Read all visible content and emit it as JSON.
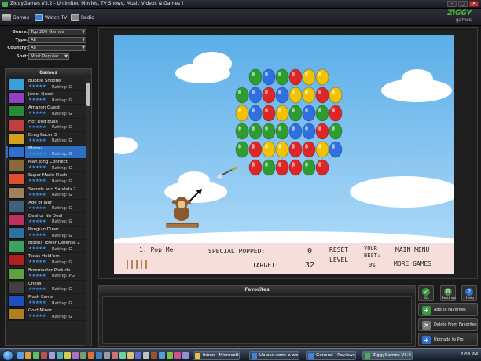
{
  "window": {
    "title": "ZiggyGames V3.2 - Unlimited Movies, TV Shows, Music Videos & Games !"
  },
  "nav": {
    "tabs": [
      {
        "label": "Games",
        "icon": "gamepad-icon"
      },
      {
        "label": "Watch TV",
        "icon": "tv-icon"
      },
      {
        "label": "Radio",
        "icon": "radio-icon"
      }
    ],
    "brand_line1": "ZIGGY",
    "brand_line2": "games"
  },
  "filters": [
    {
      "label": "Genre:",
      "value": "Top 200 Games"
    },
    {
      "label": "Type:",
      "value": "All"
    },
    {
      "label": "Country:",
      "value": "All"
    },
    {
      "label": "Sort:",
      "value": "Most Popular"
    }
  ],
  "games_panel": {
    "title": "Games",
    "rating_prefix": "Rating:",
    "items": [
      {
        "name": "Bubble Shooter",
        "stars": "★★★★★",
        "rating": "G"
      },
      {
        "name": "Jewel Quest",
        "stars": "★★★★★",
        "rating": "G"
      },
      {
        "name": "Amazon Quest",
        "stars": "★★★★★",
        "rating": "G"
      },
      {
        "name": "Hot Dog Bush",
        "stars": "★★★★★",
        "rating": "G"
      },
      {
        "name": "Drag Racer 3",
        "stars": "★★★★★",
        "rating": "G"
      },
      {
        "name": "Bloons",
        "stars": "★★★★★",
        "rating": "G",
        "selected": true
      },
      {
        "name": "Mah Jong Connect",
        "stars": "★★★★★",
        "rating": "G"
      },
      {
        "name": "Super Mario Flash",
        "stars": "★★★★★",
        "rating": "G"
      },
      {
        "name": "Swords and Sandals 2",
        "stars": "★★★★★",
        "rating": "G"
      },
      {
        "name": "Age of War",
        "stars": "★★★★★",
        "rating": "G"
      },
      {
        "name": "Deal or No Deal",
        "stars": "★★★★★",
        "rating": "G"
      },
      {
        "name": "Penguin Diner",
        "stars": "★★★★★",
        "rating": "G"
      },
      {
        "name": "Bloons Tower Defense 2",
        "stars": "★★★★★",
        "rating": "G"
      },
      {
        "name": "Texas Hold'em",
        "stars": "★★★★★",
        "rating": "G"
      },
      {
        "name": "Bowmaster Prelude",
        "stars": "★★★★★",
        "rating": "PG"
      },
      {
        "name": "Chess",
        "stars": "★★★★★",
        "rating": "G"
      },
      {
        "name": "Flash Sonic",
        "stars": "★★★★★",
        "rating": "G"
      },
      {
        "name": "Gold Miner",
        "stars": "★★★★★",
        "rating": "G"
      }
    ]
  },
  "game": {
    "level_name": "1. Pop Me",
    "special_label": "SPECIAL POPPED:",
    "special_value": "0",
    "target_label": "TARGET:",
    "target_value": "32",
    "reset_label_1": "RESET",
    "reset_label_2": "LEVEL",
    "best_label_1": "YOUR",
    "best_label_2": "BEST:",
    "best_value": "0%",
    "main_menu": "MAIN MENU",
    "more_games": "MORE GAMES",
    "balloon_colors": [
      "#e02525",
      "#2e9c2e",
      "#2f6fe0",
      "#f2c200"
    ]
  },
  "favorites": {
    "title": "Favorites"
  },
  "actions": {
    "ok": "Ok",
    "settings": "Settings",
    "help": "Help",
    "add_fav": "Add To Favorites",
    "del_fav": "Delete From Favorites",
    "upgrade": "Upgrade to Pro"
  },
  "taskbar": {
    "tasks": [
      {
        "label": "Inbox - Microsoft ..."
      },
      {
        "label": "Upload.com: a we..."
      },
      {
        "label": "General - Reviews ..."
      },
      {
        "label": "ZiggyGames V3.2 ...",
        "active": true
      }
    ],
    "clock": "2:08 PM"
  }
}
